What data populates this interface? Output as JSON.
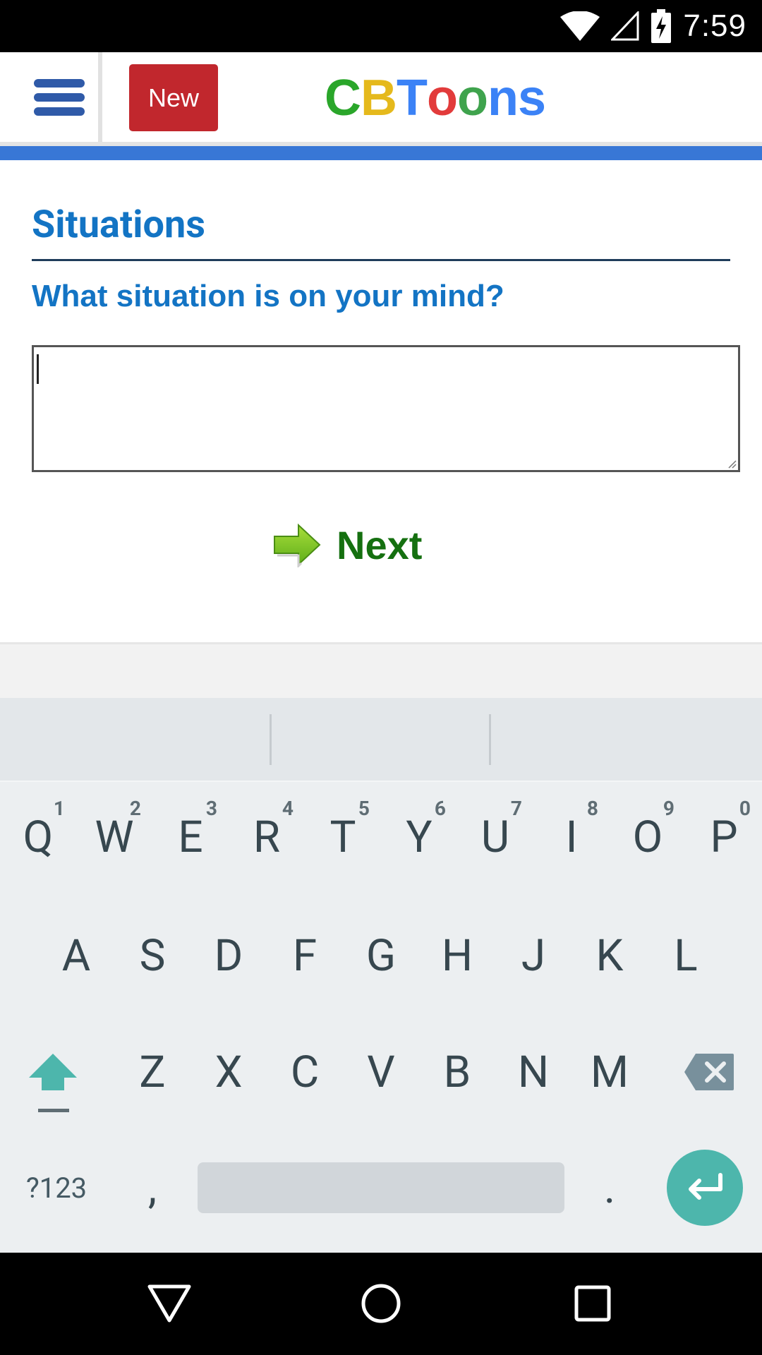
{
  "status_bar": {
    "time": "7:59",
    "icons": [
      "wifi-icon",
      "cell-signal-icon",
      "battery-charging-icon"
    ]
  },
  "header": {
    "menu_icon": "hamburger-menu-icon",
    "new_button_label": "New",
    "logo": {
      "c": "C",
      "b": "B",
      "t": "T",
      "o1": "o",
      "o2": "o",
      "n": "n",
      "s": "s"
    }
  },
  "main": {
    "title": "Situations",
    "question": "What situation is on your mind?",
    "situation_input": {
      "value": "",
      "placeholder": ""
    },
    "next_button_label": "Next",
    "next_icon": "green-right-arrow-icon"
  },
  "keyboard": {
    "row1": [
      {
        "key": "Q",
        "hint": "1"
      },
      {
        "key": "W",
        "hint": "2"
      },
      {
        "key": "E",
        "hint": "3"
      },
      {
        "key": "R",
        "hint": "4"
      },
      {
        "key": "T",
        "hint": "5"
      },
      {
        "key": "Y",
        "hint": "6"
      },
      {
        "key": "U",
        "hint": "7"
      },
      {
        "key": "I",
        "hint": "8"
      },
      {
        "key": "O",
        "hint": "9"
      },
      {
        "key": "P",
        "hint": "0"
      }
    ],
    "row2": [
      "A",
      "S",
      "D",
      "F",
      "G",
      "H",
      "J",
      "K",
      "L"
    ],
    "row3": [
      "Z",
      "X",
      "C",
      "V",
      "B",
      "N",
      "M"
    ],
    "symbols_label": "?123",
    "comma": ",",
    "period": ".",
    "shift_icon": "shift-icon",
    "backspace_icon": "backspace-icon",
    "enter_icon": "enter-icon"
  },
  "nav_bar": {
    "back_icon": "back-triangle-icon",
    "home_icon": "home-circle-icon",
    "recents_icon": "recents-square-icon"
  },
  "colors": {
    "accent_blue": "#1374c4",
    "strip_blue": "#3877d6",
    "new_red": "#c1272d",
    "next_green": "#157010",
    "enter_teal": "#4db6ac"
  }
}
